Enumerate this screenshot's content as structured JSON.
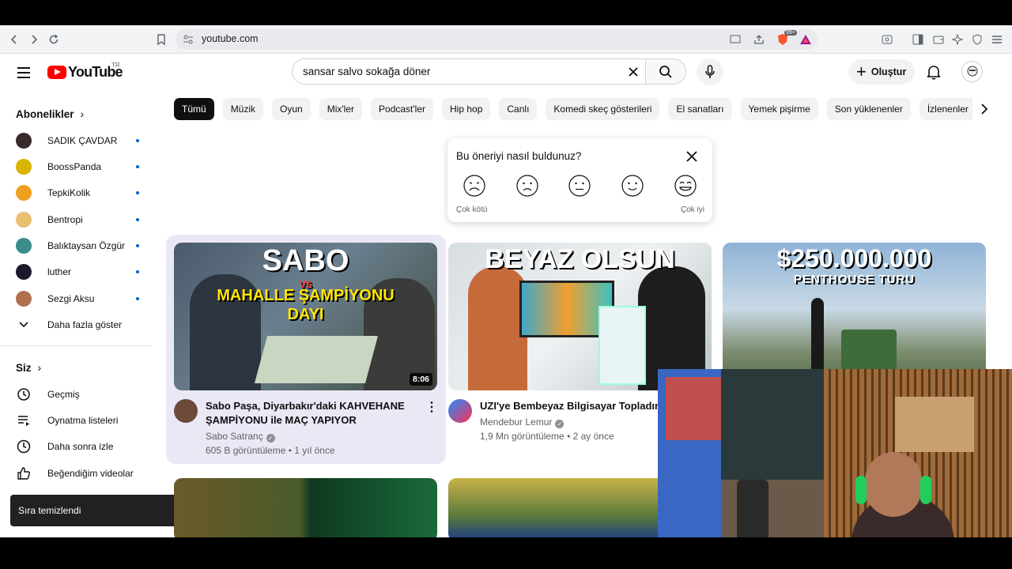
{
  "browser": {
    "url": "youtube.com",
    "badge_count": "99+"
  },
  "header": {
    "logo_text": "YouTube",
    "country_code": "TR",
    "search_value": "sansar salvo sokağa döner",
    "create_label": "Oluştur"
  },
  "sidebar": {
    "subscriptions_heading": "Abonelikler",
    "subscriptions": [
      {
        "label": "SADIK ÇAVDAR",
        "color": "#3a2a2a"
      },
      {
        "label": "BoossPanda",
        "color": "#d8b400"
      },
      {
        "label": "TepkiKolik",
        "color": "#f0a020"
      },
      {
        "label": "Bentropi",
        "color": "#e8c070"
      },
      {
        "label": "Balıktaysan Özgür",
        "color": "#3b8c8c"
      },
      {
        "label": "luther",
        "color": "#1a1a2a"
      },
      {
        "label": "Sezgi Aksu",
        "color": "#b07050"
      }
    ],
    "show_more": "Daha fazla göster",
    "you_heading": "Siz",
    "you_items": [
      {
        "label": "Geçmiş",
        "icon": "history-icon"
      },
      {
        "label": "Oynatma listeleri",
        "icon": "playlist-icon"
      },
      {
        "label": "Daha sonra izle",
        "icon": "clock-icon"
      },
      {
        "label": "Beğendiğim videolar",
        "icon": "thumbs-up-icon"
      }
    ]
  },
  "toast": "Sıra temizlendi",
  "chips": [
    "Tümü",
    "Müzik",
    "Oyun",
    "Mix'ler",
    "Podcast'ler",
    "Hip hop",
    "Canlı",
    "Komedi skeç gösterileri",
    "El sanatları",
    "Yemek pişirme",
    "Son yüklenenler",
    "İzlenenler"
  ],
  "survey": {
    "question": "Bu öneriyi nasıl buldunuz?",
    "min_label": "Çok kötü",
    "max_label": "Çok iyi"
  },
  "videos": [
    {
      "thumb_line1": "SABO",
      "thumb_line2": "VS",
      "thumb_line3": "MAHALLE ŞAMPİYONU",
      "thumb_line4": "DAYI",
      "duration": "8:06",
      "title": "Sabo Paşa, Diyarbakır'daki KAHVEHANE ŞAMPİYONU ile MAÇ YAPIYOR",
      "channel": "Sabo Satranç",
      "meta": "605 B görüntüleme • 1 yıl önce"
    },
    {
      "thumb_line1": "BEYAZ OLSUN",
      "title": "UZI'ye Bembeyaz Bilgisayar Topladım!",
      "channel": "Mendebur Lemur",
      "meta": "1,9 Mn görüntüleme • 2 ay önce"
    },
    {
      "thumb_line1": "$250.000.000",
      "thumb_line2": "PENTHOUSE TURU"
    }
  ],
  "colors": {
    "youtube_red": "#ff0000",
    "hover_card": "#ebe8f6",
    "subscription_dot": "#065fd4"
  }
}
